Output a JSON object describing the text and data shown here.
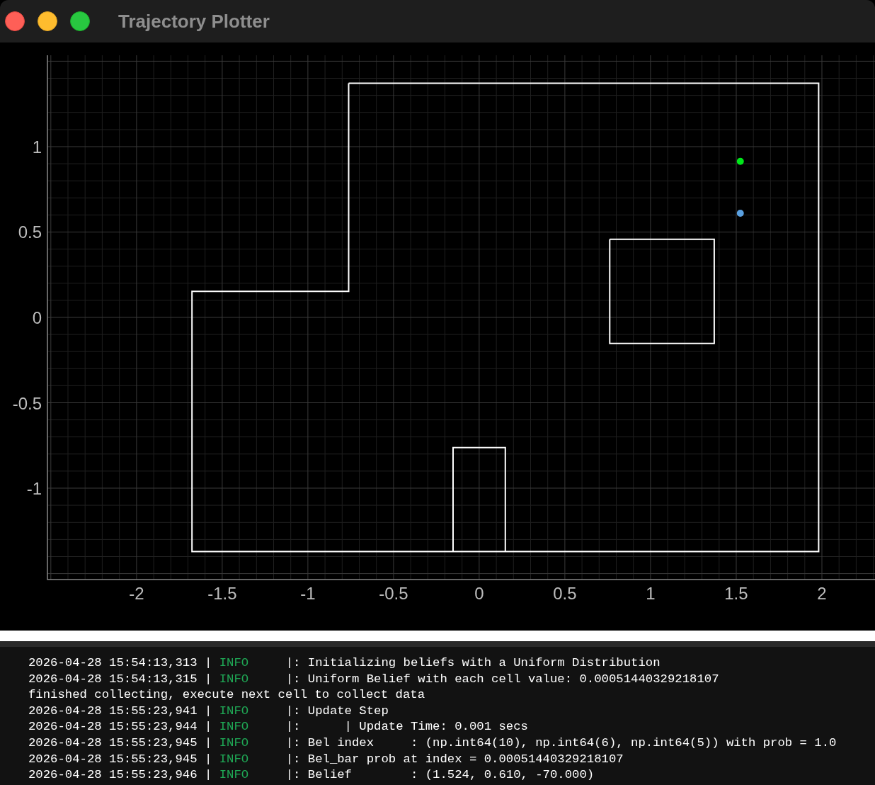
{
  "window": {
    "title": "Trajectory Plotter"
  },
  "plot": {
    "chart_data": {
      "type": "scatter",
      "grid": true,
      "x": [
        1.524
      ],
      "xlim": [
        -2.52,
        2.31
      ],
      "ylim": [
        -1.535,
        1.535
      ],
      "xticks": [
        -2,
        -1.5,
        -1,
        -0.5,
        0,
        0.5,
        1,
        1.5,
        2
      ],
      "yticks": [
        -1,
        -0.5,
        0,
        0.5,
        1
      ],
      "series": [
        {
          "color": "#00e61a",
          "values": [
            0.914
          ]
        },
        {
          "color": "#5aa0e0",
          "values": [
            0.61
          ]
        }
      ]
    }
  },
  "terminal": {
    "lines": [
      {
        "kind": "log",
        "timestamp": "2026-04-28 15:54:13,313 |",
        "level": "INFO",
        "message": "|: Initializing beliefs with a Uniform Distribution"
      },
      {
        "kind": "log",
        "timestamp": "2026-04-28 15:54:13,315 |",
        "level": "INFO",
        "message": "|: Uniform Belief with each cell value: 0.00051440329218107"
      },
      {
        "kind": "plain",
        "text": "finished collecting, execute next cell to collect data"
      },
      {
        "kind": "log",
        "timestamp": "2026-04-28 15:55:23,941 |",
        "level": "INFO",
        "message": "|: Update Step"
      },
      {
        "kind": "log",
        "timestamp": "2026-04-28 15:55:23,944 |",
        "level": "INFO",
        "message": "|:      | Update Time: 0.001 secs"
      },
      {
        "kind": "log",
        "timestamp": "2026-04-28 15:55:23,945 |",
        "level": "INFO",
        "message": "|: Bel index     : (np.int64(10), np.int64(6), np.int64(5)) with prob = 1.0"
      },
      {
        "kind": "log",
        "timestamp": "2026-04-28 15:55:23,945 |",
        "level": "INFO",
        "message": "|: Bel_bar prob at index = 0.00051440329218107"
      },
      {
        "kind": "log",
        "timestamp": "2026-04-28 15:55:23,946 |",
        "level": "INFO",
        "message": "|: Belief        : (1.524, 0.610, -70.000)"
      }
    ]
  }
}
